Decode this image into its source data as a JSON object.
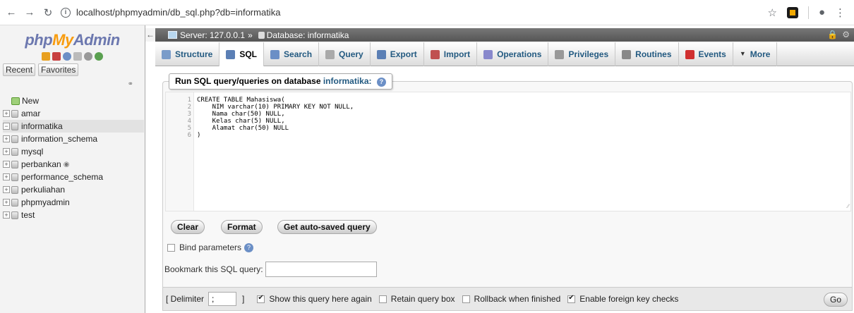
{
  "browser": {
    "url": "localhost/phpmyadmin/db_sql.php?db=informatika",
    "icons": [
      "back-arrow-icon",
      "forward-arrow-icon",
      "reload-icon",
      "info-icon",
      "star-icon",
      "extension-icon",
      "account-icon",
      "kebab-menu-icon"
    ]
  },
  "logo": {
    "php": "php",
    "my": "My",
    "admin": "Admin"
  },
  "leftnav": {
    "recent": "Recent",
    "favorites": "Favorites",
    "tree": [
      {
        "label": "New",
        "type": "new",
        "expander": ""
      },
      {
        "label": "amar",
        "type": "db",
        "expander": "+"
      },
      {
        "label": "informatika",
        "type": "db",
        "expander": "−",
        "selected": true
      },
      {
        "label": "information_schema",
        "type": "db",
        "expander": "+"
      },
      {
        "label": "mysql",
        "type": "db",
        "expander": "+"
      },
      {
        "label": "perbankan",
        "type": "db",
        "expander": "+",
        "eye": true
      },
      {
        "label": "performance_schema",
        "type": "db",
        "expander": "+"
      },
      {
        "label": "perkuliahan",
        "type": "db",
        "expander": "+"
      },
      {
        "label": "phpmyadmin",
        "type": "db",
        "expander": "+"
      },
      {
        "label": "test",
        "type": "db",
        "expander": "+"
      }
    ]
  },
  "breadcrumb": {
    "server": "Server: 127.0.0.1",
    "sep": "»",
    "database": "Database: informatika"
  },
  "tabs": [
    {
      "label": "Structure",
      "icon": "structure-icon",
      "color": "#7a9cc9"
    },
    {
      "label": "SQL",
      "icon": "sql-icon",
      "color": "#5b7fb5",
      "active": true
    },
    {
      "label": "Search",
      "icon": "search-icon",
      "color": "#6b8fc6"
    },
    {
      "label": "Query",
      "icon": "query-icon",
      "color": "#aaaaaa"
    },
    {
      "label": "Export",
      "icon": "export-icon",
      "color": "#5b7fb5"
    },
    {
      "label": "Import",
      "icon": "import-icon",
      "color": "#c05050"
    },
    {
      "label": "Operations",
      "icon": "operations-icon",
      "color": "#8888cc"
    },
    {
      "label": "Privileges",
      "icon": "privileges-icon",
      "color": "#999999"
    },
    {
      "label": "Routines",
      "icon": "routines-icon",
      "color": "#888888"
    },
    {
      "label": "Events",
      "icon": "events-icon",
      "color": "#d03030"
    },
    {
      "label": "More",
      "icon": "chevron-down-icon",
      "color": "#333333"
    }
  ],
  "sql_panel": {
    "title_prefix": "Run SQL query/queries on database",
    "database": "informatika:",
    "lines": [
      "CREATE TABLE Mahasiswa(",
      "    NIM varchar(10) PRIMARY KEY NOT NULL,",
      "    Nama char(50) NULL,",
      "    Kelas char(5) NULL,",
      "    Alamat char(50) NULL",
      ")"
    ],
    "line_numbers": [
      "1",
      "2",
      "3",
      "4",
      "5",
      "6"
    ]
  },
  "buttons": {
    "clear": "Clear",
    "format": "Format",
    "autosaved": "Get auto-saved query",
    "go": "Go"
  },
  "bind_parameters": "Bind parameters",
  "bookmark_label": "Bookmark this SQL query:",
  "footer": {
    "delimiter_label": "[ Delimiter",
    "delimiter_value": ";",
    "delimiter_close": "]",
    "show_again": "Show this query here again",
    "retain": "Retain query box",
    "rollback": "Rollback when finished",
    "foreign_keys": "Enable foreign key checks"
  }
}
